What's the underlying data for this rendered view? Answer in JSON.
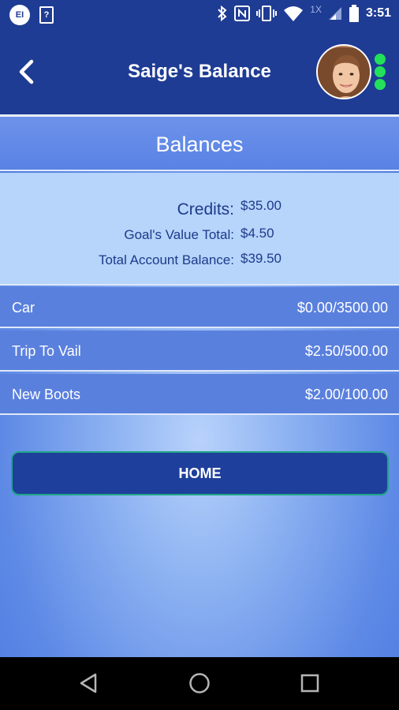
{
  "status_bar": {
    "left_icons": [
      "notification-badge-icon",
      "sim-card-icon"
    ],
    "badge_text": "EI",
    "sim_text": "?",
    "right_icons": [
      "bluetooth-icon",
      "nfc-icon",
      "vibrate-icon",
      "wifi-icon",
      "signal-icon",
      "battery-icon"
    ],
    "network_label": "1X",
    "time": "3:51"
  },
  "header": {
    "title": "Saige's Balance",
    "back_icon": "chevron-left-icon",
    "menu_icon": "vertical-dots-icon",
    "accent_dot_color": "#22e05a"
  },
  "balances": {
    "section_title": "Balances",
    "summary": [
      {
        "label": "Credits:",
        "value": "$35.00"
      },
      {
        "label": "Goal's Value Total:",
        "value": "$4.50"
      },
      {
        "label": "Total Account Balance:",
        "value": "$39.50"
      }
    ]
  },
  "goals": [
    {
      "name": "Car",
      "amount": "$0.00/3500.00"
    },
    {
      "name": "Trip To Vail",
      "amount": "$2.50/500.00"
    },
    {
      "name": "New Boots",
      "amount": "$2.00/100.00"
    }
  ],
  "actions": {
    "home_label": "HOME"
  },
  "nav_bar": {
    "icons": [
      "back-triangle-icon",
      "home-circle-icon",
      "recents-square-icon"
    ]
  },
  "colors": {
    "header": "#1f3c94",
    "button": "#1f3f9c",
    "button_border": "#1fa587",
    "row": "#5a80de",
    "summary_bg": "#b7d4fb"
  }
}
